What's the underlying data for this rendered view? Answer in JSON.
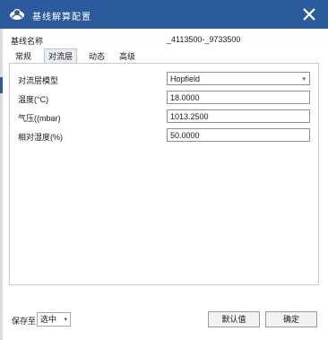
{
  "window": {
    "title": "基线解算配置",
    "close_icon": "close-icon"
  },
  "baseline": {
    "label": "基线名称",
    "value": "_4113500-_9733500"
  },
  "tabs": [
    {
      "label": "常规",
      "active": false
    },
    {
      "label": "对流层",
      "active": true
    },
    {
      "label": "动态",
      "active": false
    },
    {
      "label": "高级",
      "active": false
    }
  ],
  "troposphere": {
    "model_label": "对流层模型",
    "model_value": "Hopfield",
    "temperature_label": "温度(°C)",
    "temperature_value": "18.0000",
    "pressure_label": "气压((mbar)",
    "pressure_value": "1013.2500",
    "humidity_label": "相对湿度(%)",
    "humidity_value": "50.0000"
  },
  "footer": {
    "save_to_label": "保存至",
    "save_to_value": "选中",
    "default_button": "默认值",
    "ok_button": "确定"
  },
  "colors": {
    "titlebar": "#2b5a9d"
  }
}
